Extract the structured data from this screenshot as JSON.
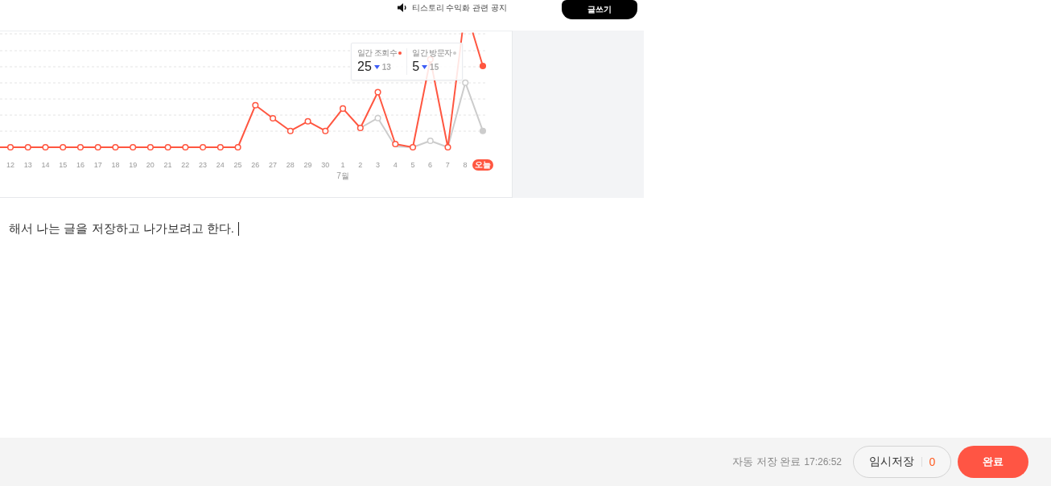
{
  "header": {
    "notice": "티스토리 수익화 관련 공지",
    "write_button": "글쓰기"
  },
  "chart": {
    "tooltip": [
      {
        "label": "일간 조회수",
        "color": "#ff5640",
        "value": "25",
        "decreased": true,
        "delta": "13"
      },
      {
        "label": "일간 방문자",
        "color": "#cccccc",
        "value": "5",
        "decreased": true,
        "delta": "15"
      }
    ],
    "dates": [
      {
        "label": "12",
        "selected": false
      },
      {
        "label": "13",
        "selected": false
      },
      {
        "label": "14",
        "selected": false
      },
      {
        "label": "15",
        "selected": false
      },
      {
        "label": "16",
        "selected": false
      },
      {
        "label": "17",
        "selected": false
      },
      {
        "label": "18",
        "selected": false
      },
      {
        "label": "19",
        "selected": false
      },
      {
        "label": "20",
        "selected": false
      },
      {
        "label": "21",
        "selected": false
      },
      {
        "label": "22",
        "selected": false
      },
      {
        "label": "23",
        "selected": false
      },
      {
        "label": "24",
        "selected": false
      },
      {
        "label": "25",
        "selected": false
      },
      {
        "label": "26",
        "selected": false
      },
      {
        "label": "27",
        "selected": false
      },
      {
        "label": "28",
        "selected": false
      },
      {
        "label": "29",
        "selected": false
      },
      {
        "label": "30",
        "selected": false
      },
      {
        "label": "1",
        "selected": false,
        "month": "7월"
      },
      {
        "label": "2",
        "selected": false
      },
      {
        "label": "3",
        "selected": false
      },
      {
        "label": "4",
        "selected": false
      },
      {
        "label": "5",
        "selected": false
      },
      {
        "label": "6",
        "selected": false
      },
      {
        "label": "7",
        "selected": false
      },
      {
        "label": "8",
        "selected": false
      },
      {
        "label": "오늘",
        "selected": true
      }
    ]
  },
  "editor": {
    "text": "해서 나는 글을 저장하고 나가보려고 한다.",
    "focused": true
  },
  "footer": {
    "autosave_label": "자동 저장 완료",
    "autosave_time": "17:26:52",
    "draft_button": "임시저장",
    "draft_count": "0",
    "publish_button": "완료"
  }
}
